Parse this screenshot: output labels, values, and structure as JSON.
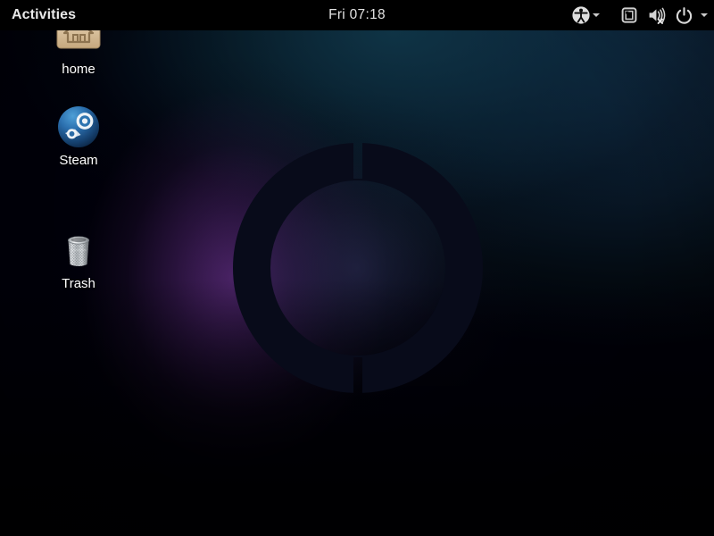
{
  "panel": {
    "activities_label": "Activities",
    "clock": "Fri 07:18",
    "tray": [
      {
        "name": "accessibility-icon",
        "label": "Accessibility"
      },
      {
        "name": "chevron-down-icon",
        "label": ""
      },
      {
        "name": "display-icon",
        "label": "Display"
      },
      {
        "name": "volume-muted-icon",
        "label": "Volume muted"
      },
      {
        "name": "power-icon",
        "label": "Power"
      },
      {
        "name": "chevron-down-icon",
        "label": ""
      }
    ]
  },
  "desktop": {
    "icons": [
      {
        "label": "home",
        "icon": "folder-home-icon"
      },
      {
        "label": "Steam",
        "icon": "steam-icon"
      },
      {
        "label": "Trash",
        "icon": "trash-icon"
      }
    ],
    "wallpaper": {
      "logo": "ring-logo",
      "base_color": "#000009",
      "navy_color": "#0d2339",
      "teal_color": "#10384a",
      "purple_color": "#3b1d50",
      "ring_color": "#080b1a"
    }
  }
}
